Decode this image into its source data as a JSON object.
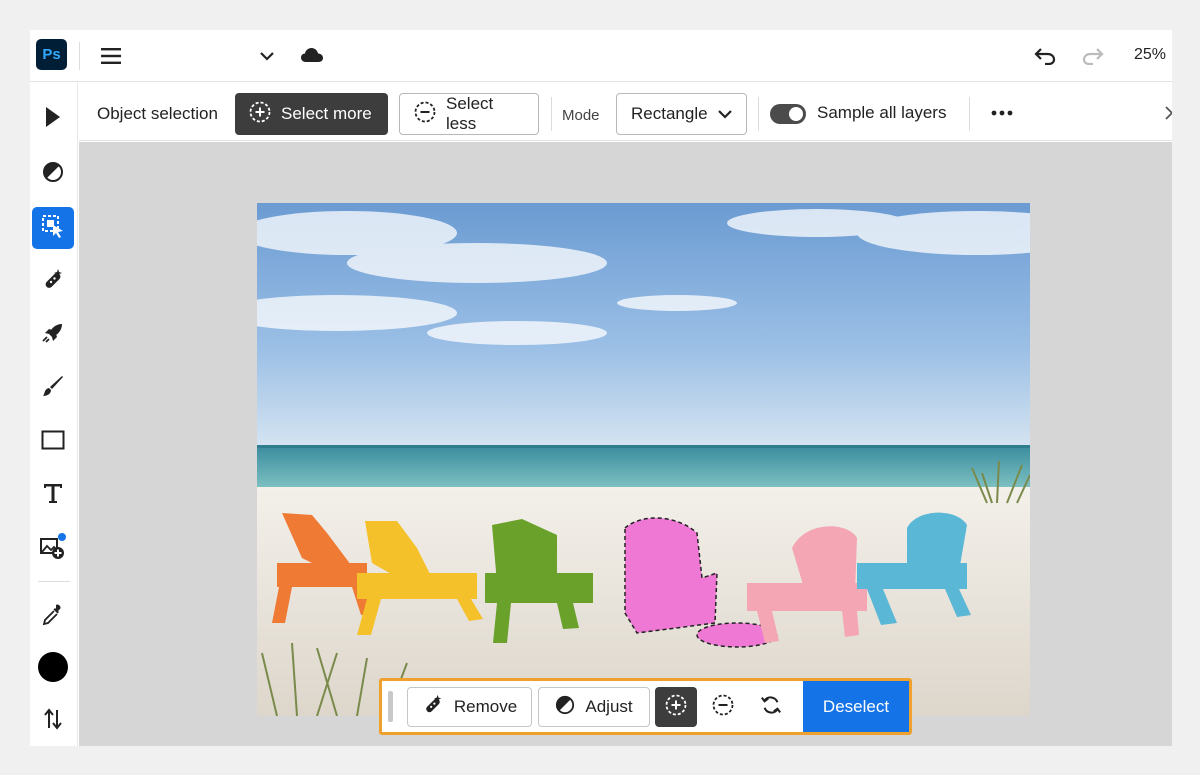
{
  "app": {
    "logo": "Ps",
    "zoom": "25%"
  },
  "icons": {
    "menu": "hamburger-icon",
    "dropdown": "chevron-down-icon",
    "cloud": "cloud-icon",
    "undo": "undo-icon",
    "redo": "redo-icon"
  },
  "tools": [
    {
      "name": "move-tool",
      "icon": "arrow-pointer-icon",
      "active": false
    },
    {
      "name": "adjust-tool",
      "icon": "half-circle-icon",
      "active": false
    },
    {
      "name": "object-selection-tool",
      "icon": "object-select-icon",
      "active": true
    },
    {
      "name": "healing-tool",
      "icon": "bandage-icon",
      "active": false
    },
    {
      "name": "quick-actions-tool",
      "icon": "rocket-icon",
      "active": false
    },
    {
      "name": "brush-tool",
      "icon": "brush-icon",
      "active": false
    },
    {
      "name": "shape-tool",
      "icon": "rectangle-icon",
      "active": false
    },
    {
      "name": "type-tool",
      "icon": "type-icon",
      "active": false
    },
    {
      "name": "add-image-tool",
      "icon": "add-image-icon",
      "active": false
    },
    {
      "name": "eyedropper-tool",
      "icon": "eyedropper-icon",
      "active": false
    },
    {
      "name": "color-swatch",
      "icon": "color-circle-icon",
      "active": false
    },
    {
      "name": "swap-colors",
      "icon": "swap-arrows-icon",
      "active": false
    }
  ],
  "options": {
    "tool_label": "Object selection",
    "select_more": "Select more",
    "select_less": "Select less",
    "mode_label": "Mode",
    "mode_value": "Rectangle",
    "sample_all_layers": "Sample all layers",
    "sample_all_layers_on": true
  },
  "context_bar": {
    "remove": "Remove",
    "adjust": "Adjust",
    "deselect": "Deselect"
  },
  "colors": {
    "accent": "#1473e6",
    "dark_button": "#3d3d3d",
    "highlight_border": "#f0a02c",
    "foreground_color": "#000000"
  }
}
